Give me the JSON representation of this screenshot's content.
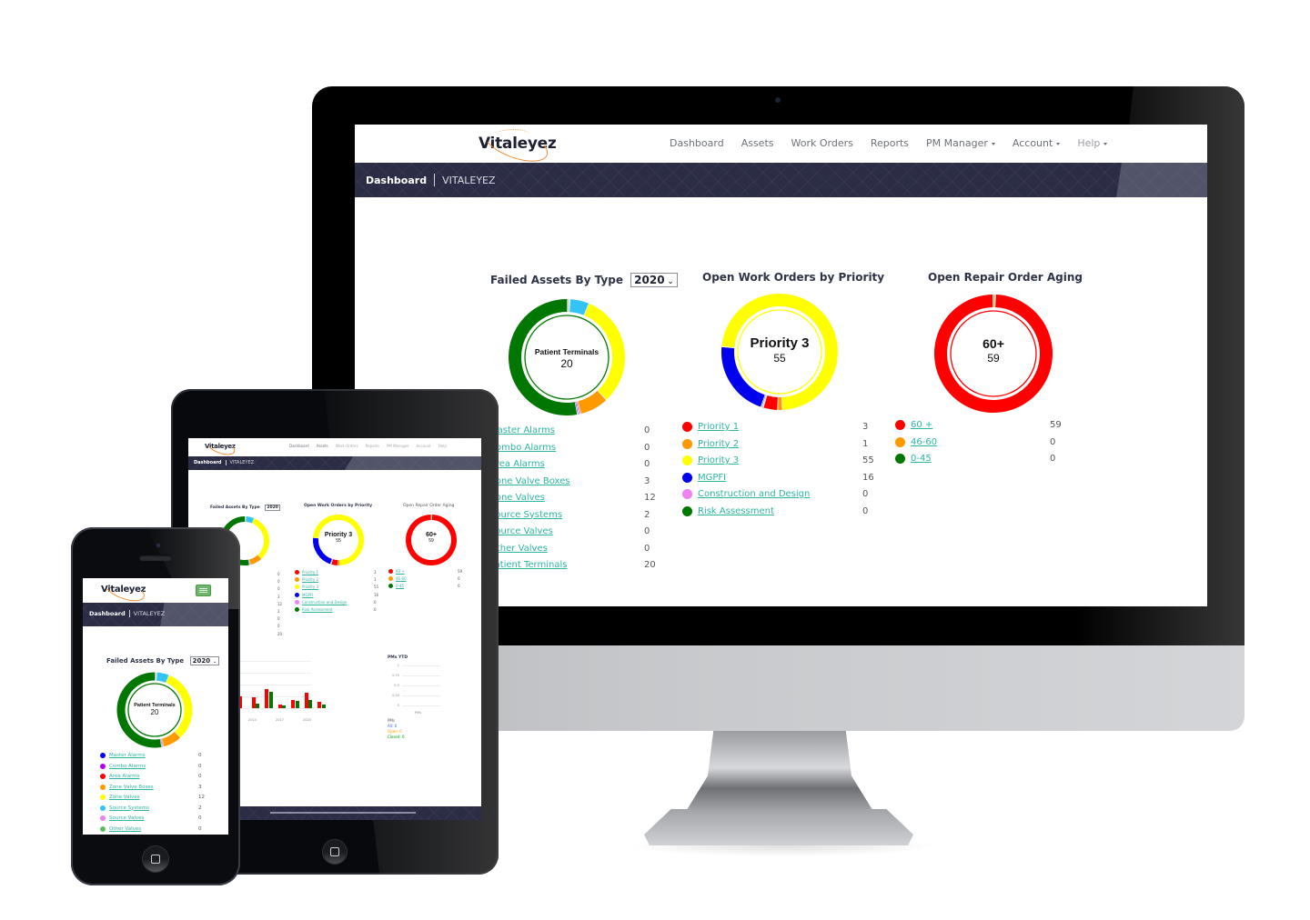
{
  "app": {
    "brand": "Vitaleyez",
    "nav": [
      {
        "label": "Dashboard",
        "dropdown": false
      },
      {
        "label": "Assets",
        "dropdown": false
      },
      {
        "label": "Work Orders",
        "dropdown": false
      },
      {
        "label": "Reports",
        "dropdown": false
      },
      {
        "label": "PM Manager",
        "dropdown": true
      },
      {
        "label": "Account",
        "dropdown": true
      },
      {
        "label": "Help",
        "dropdown": true
      }
    ],
    "breadcrumb": {
      "current": "Dashboard",
      "context": "VITALEYEZ"
    }
  },
  "widgets": {
    "failed_assets": {
      "title": "Failed Assets By Type",
      "year": "2020",
      "center_label": "Patient Terminals",
      "center_value": "20",
      "items": [
        {
          "label": "Master Alarms",
          "value": 0,
          "color": "#0000ee"
        },
        {
          "label": "Combo Alarms",
          "value": 0,
          "color": "#b000f0"
        },
        {
          "label": "Area Alarms",
          "value": 0,
          "color": "#ff0000"
        },
        {
          "label": "Zone Valve Boxes",
          "value": 3,
          "color": "#ff9900"
        },
        {
          "label": "Zone Valves",
          "value": 12,
          "color": "#ffff00"
        },
        {
          "label": "Source Systems",
          "value": 2,
          "color": "#33c3f5"
        },
        {
          "label": "Source Valves",
          "value": 0,
          "color": "#ee82ee"
        },
        {
          "label": "Other Valves",
          "value": 0,
          "color": "#5cbf5c"
        },
        {
          "label": "Patient Terminals",
          "value": 20,
          "color": "#007700"
        }
      ]
    },
    "work_orders": {
      "title": "Open Work Orders by Priority",
      "center_label": "Priority 3",
      "center_value": "55",
      "items": [
        {
          "label": "Priority 1",
          "value": 3,
          "color": "#ff0000"
        },
        {
          "label": "Priority 2",
          "value": 1,
          "color": "#ff9900"
        },
        {
          "label": "Priority 3",
          "value": 55,
          "color": "#ffff00"
        },
        {
          "label": "MGPFI",
          "value": 16,
          "color": "#0000ee"
        },
        {
          "label": "Construction and Design",
          "value": 0,
          "color": "#ee82ee"
        },
        {
          "label": "Risk Assessment",
          "value": 0,
          "color": "#007700"
        }
      ]
    },
    "repair_aging": {
      "title": "Open Repair Order Aging",
      "center_label": "60+",
      "center_value": "59",
      "items": [
        {
          "label": "60 +",
          "value": 59,
          "color": "#ff0000"
        },
        {
          "label": "46-60",
          "value": 0,
          "color": "#ff9900"
        },
        {
          "label": "0-45",
          "value": 0,
          "color": "#007700"
        }
      ]
    },
    "history_bars": {
      "x_ticks": [
        "2014",
        "2017",
        "2020"
      ],
      "series_colors": {
        "a": "#ff0000",
        "b": "#007700"
      },
      "pairs": [
        [
          0.55,
          null
        ],
        [
          0.5,
          0.2
        ],
        [
          0.88,
          0.78
        ],
        [
          0.17,
          0.14
        ],
        [
          0.38,
          0.36
        ],
        [
          0.72,
          0.38
        ],
        [
          0.3,
          0.16
        ]
      ]
    },
    "pms_ytd": {
      "title": "PMs YTD",
      "y_ticks": [
        "1",
        "0.75",
        "0.5",
        "0.25",
        "0"
      ],
      "x_label": "PMs",
      "legend_title": "PMs",
      "legend": [
        {
          "label": "All: 0",
          "color": "#3355ff"
        },
        {
          "label": "Open: 0",
          "color": "#ff9900"
        },
        {
          "label": "Closed: 0",
          "color": "#009900"
        }
      ]
    }
  }
}
